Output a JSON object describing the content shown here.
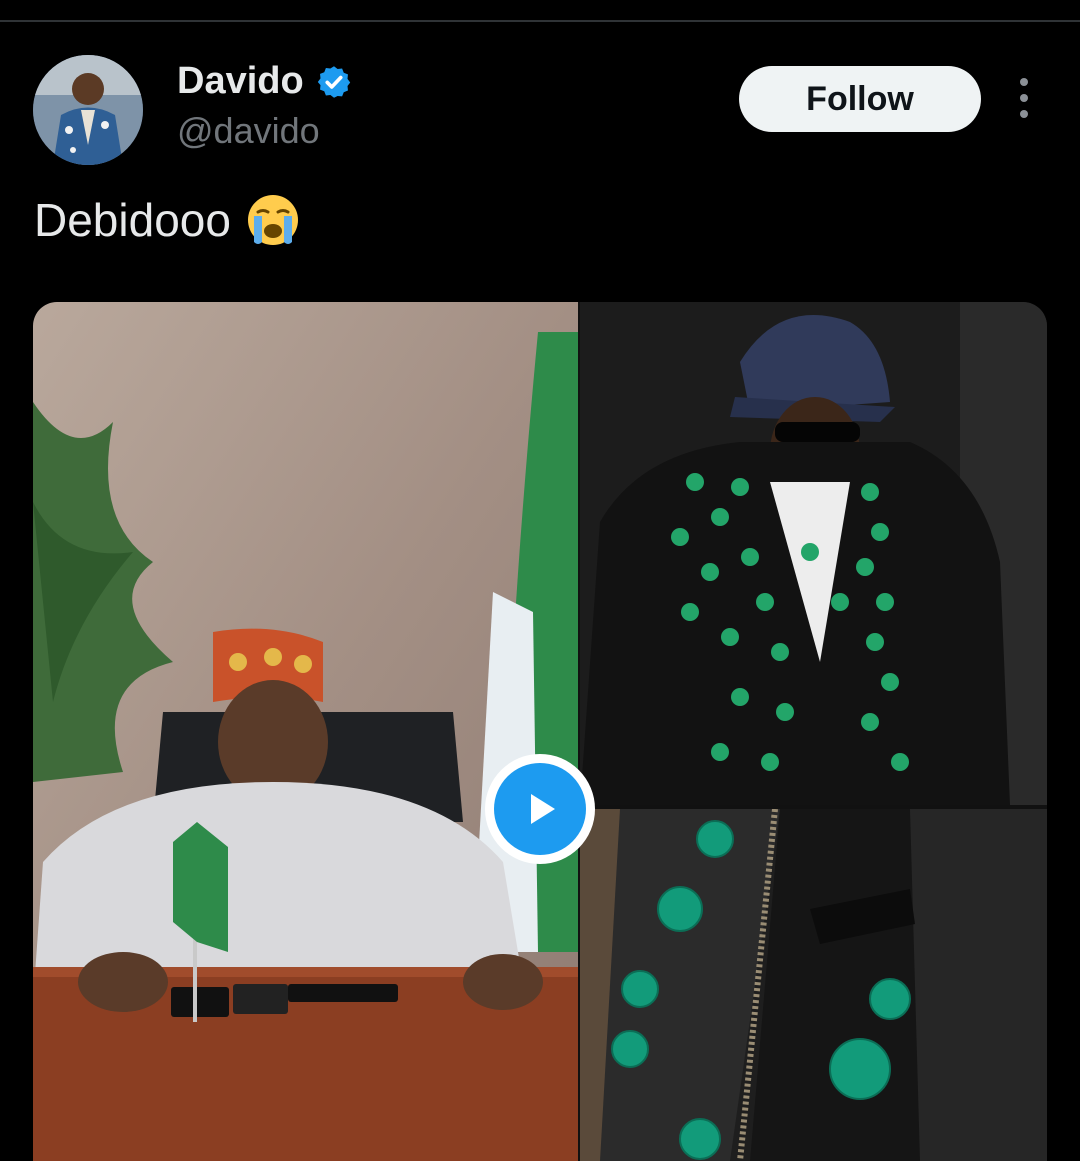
{
  "author": {
    "display_name": "Davido",
    "handle": "@davido",
    "verified": true,
    "avatar_icon": "avatar-photo"
  },
  "actions": {
    "follow_label": "Follow",
    "more_icon": "more-vertical-icon"
  },
  "tweet": {
    "text": "Debidooo",
    "emoji": "loudly-crying-face"
  },
  "media": {
    "items": [
      {
        "kind": "video",
        "subject": "man seated at desk with Nigerian flags"
      },
      {
        "kind": "photo",
        "subject": "man in leather jacket with green pins"
      },
      {
        "kind": "photo",
        "subject": "close-up of leather jacket pins"
      }
    ],
    "play_icon": "play-icon"
  },
  "colors": {
    "background": "#000000",
    "accent": "#1d9bf0",
    "follow_bg": "#eff3f4",
    "secondary_text": "#71767b"
  }
}
